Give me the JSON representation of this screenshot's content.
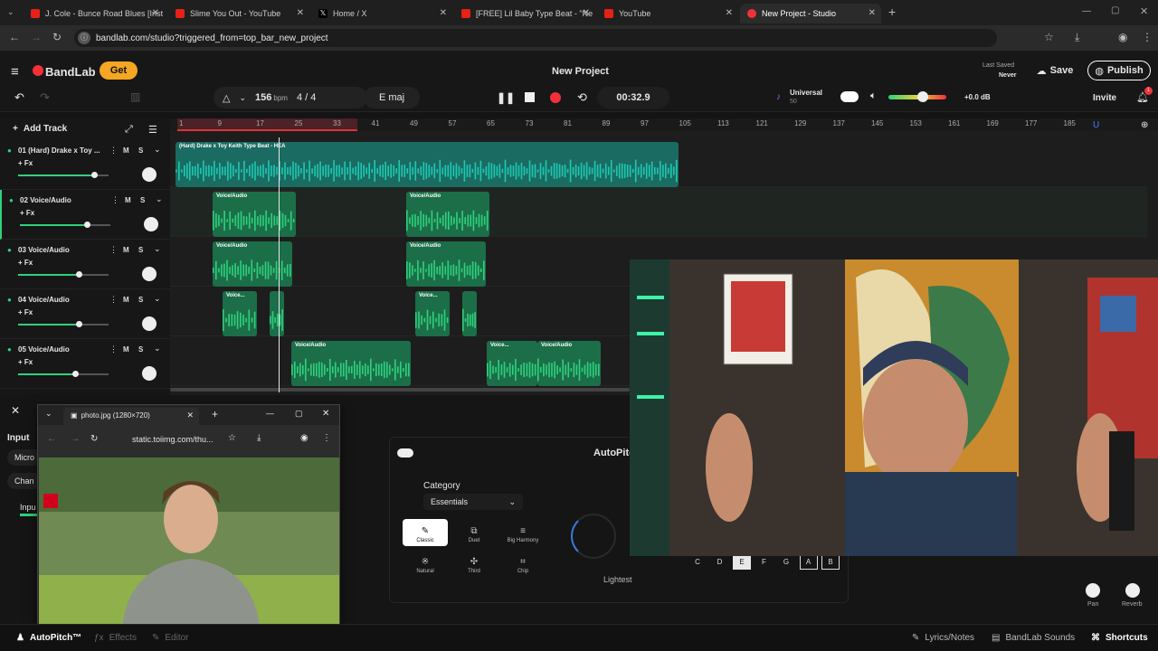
{
  "browser": {
    "tabs": [
      {
        "title": "J. Cole - Bunce Road Blues [Inst",
        "icon": "youtube-icon"
      },
      {
        "title": "Slime You Out - YouTube",
        "icon": "youtube-icon"
      },
      {
        "title": "Home / X",
        "icon": "x-icon"
      },
      {
        "title": "[FREE] Lil Baby Type Beat - \"Ne",
        "icon": "youtube-icon"
      },
      {
        "title": "YouTube",
        "icon": "youtube-icon"
      },
      {
        "title": "New Project - Studio",
        "icon": "bandlab-icon"
      }
    ],
    "url": "bandlab.com/studio?triggered_from=top_bar_new_project"
  },
  "app": {
    "brand": "BandLab",
    "get_label": "Get",
    "project_title": "New Project",
    "last_saved_label": "Last Saved",
    "last_saved_value": "Never",
    "save_label": "Save",
    "publish_label": "Publish",
    "invite_label": "Invite",
    "notification_count": "1"
  },
  "transport": {
    "bpm_value": "156",
    "bpm_unit": "bpm",
    "time_sig": "4 / 4",
    "key": "E maj",
    "time": "00:32.9",
    "preset_name": "Universal",
    "preset_sub": "50",
    "volume_db": "+0.0 dB",
    "volume_level": 0.6
  },
  "tracks": {
    "add_label": "Add Track",
    "mute": "M",
    "solo": "S",
    "fx": "+ Fx",
    "list": [
      {
        "name": "01 (Hard) Drake x Toy ...",
        "volume": 0.84
      },
      {
        "name": "02 Voice/Audio",
        "volume": 0.74
      },
      {
        "name": "03 Voice/Audio",
        "volume": 0.67
      },
      {
        "name": "04 Voice/Audio",
        "volume": 0.67
      },
      {
        "name": "05 Voice/Audio",
        "volume": 0.63
      }
    ]
  },
  "ruler": [
    "1",
    "9",
    "17",
    "25",
    "33",
    "41",
    "49",
    "57",
    "65",
    "73",
    "81",
    "89",
    "97",
    "105",
    "113",
    "121",
    "129",
    "137",
    "145",
    "153",
    "161",
    "169",
    "177",
    "185"
  ],
  "regions": {
    "beat": "(Hard) Drake x Toy Keith Type Beat - HEA",
    "voice": "Voice/Audio",
    "voice_short": "Voice...",
    "voice_trunc": "Voice/Audio"
  },
  "popup": {
    "tab_title": "photo.jpg (1280×720)",
    "url": "static.toiimg.com/thu..."
  },
  "left_panel": {
    "input": "Input",
    "mic": "Micro",
    "chan": "Chan",
    "inpu": "Inpu"
  },
  "autopitch": {
    "title": "AutoPitch",
    "category_label": "Category",
    "category_value": "Essentials",
    "presets": [
      "Classic",
      "Duet",
      "Big Harmony",
      "Natural",
      "Third",
      "Chip"
    ],
    "dial_label": "Lightest",
    "keys": [
      "C",
      "D",
      "E",
      "F",
      "G",
      "A",
      "B"
    ],
    "pan": "Pan",
    "reverb": "Reverb"
  },
  "bottom": {
    "autopitch": "AutoPitch™",
    "effects": "Effects",
    "editor": "Editor",
    "lyrics": "Lyrics/Notes",
    "sounds": "BandLab Sounds",
    "shortcuts": "Shortcuts"
  },
  "colors": {
    "accent": "#f3303a",
    "region_teal": "#1ec9b2",
    "region_green": "#2fd17d",
    "get_button": "#f5a623"
  }
}
